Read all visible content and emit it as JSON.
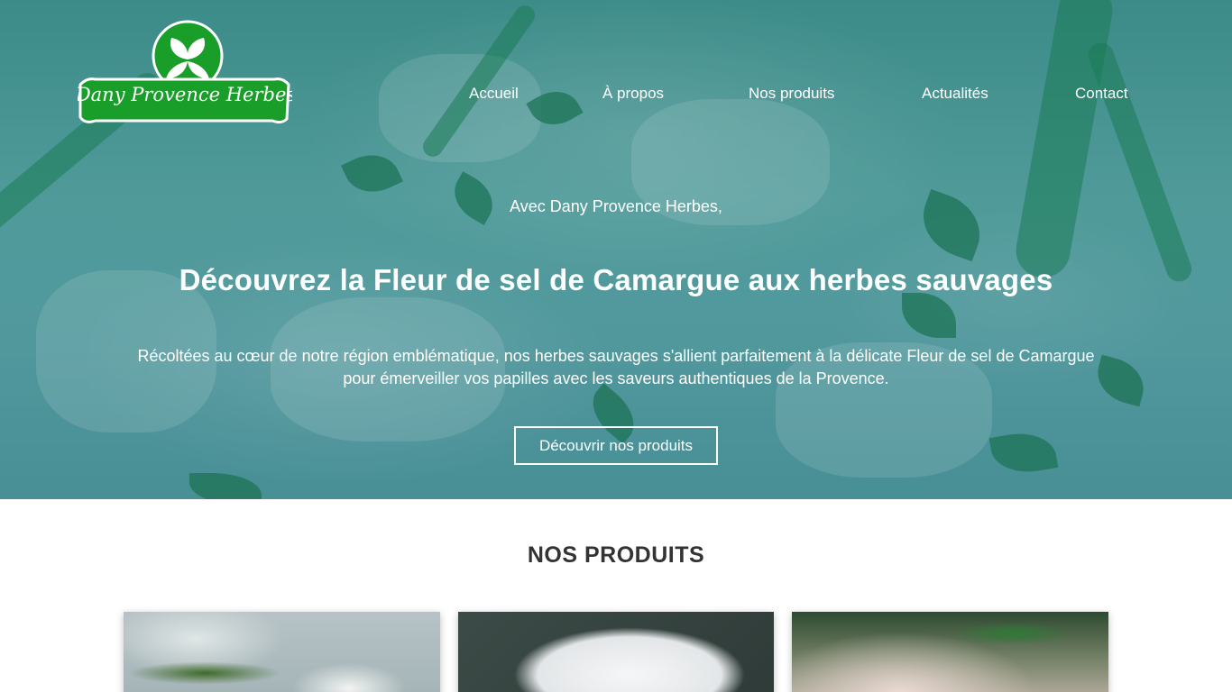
{
  "brand": {
    "logo_text": "Dany Provence Herbes"
  },
  "nav": {
    "items": [
      "Accueil",
      "À propos",
      "Nos produits",
      "Actualités",
      "Contact"
    ]
  },
  "hero": {
    "eyebrow": "Avec Dany Provence Herbes,",
    "headline": "Découvrez la Fleur de sel de Camargue aux herbes sauvages",
    "lead": "Récoltées au cœur de notre région emblématique, nos herbes sauvages s'allient parfaitement à la délicate Fleur de sel de Camargue pour émerveiller vos papilles avec les saveurs authentiques de la Provence.",
    "cta_label": "Découvrir nos produits"
  },
  "products": {
    "title": "NOS PRODUITS"
  },
  "colors": {
    "logo_green": "#1a9e2a",
    "hero_teal": "#5aa3a2",
    "text_dark": "#333333"
  }
}
